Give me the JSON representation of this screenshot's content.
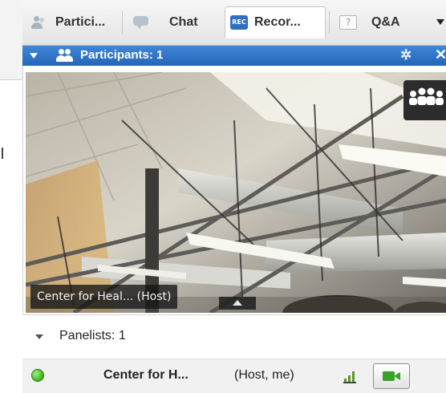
{
  "tabs": [
    {
      "label": "Partici...",
      "icon": "participants-icon"
    },
    {
      "label": "Chat",
      "icon": "chat-icon"
    },
    {
      "label": "Recor...",
      "icon": "record-icon",
      "icon_text": "REC",
      "active": true
    },
    {
      "label": "Q&A",
      "icon": "question-icon",
      "icon_text": "?"
    }
  ],
  "panel": {
    "title": "Participants: 1",
    "icon": "participants-icon",
    "settings_icon": "gear-icon",
    "settings_glyph": "✲",
    "close_icon": "close-icon",
    "close_glyph": "✕",
    "accent_color": "#2f74c9"
  },
  "video": {
    "label": "Center for Heal...  (Host)",
    "layout_icon": "group-layout-icon"
  },
  "panelists": {
    "title": "Panelists: 1",
    "members": [
      {
        "name": "Center for H...",
        "role": "(Host, me)",
        "status_color": "#3fb21b",
        "audio_icon": "audio-level-icon",
        "video_icon": "video-camera-icon"
      }
    ]
  }
}
